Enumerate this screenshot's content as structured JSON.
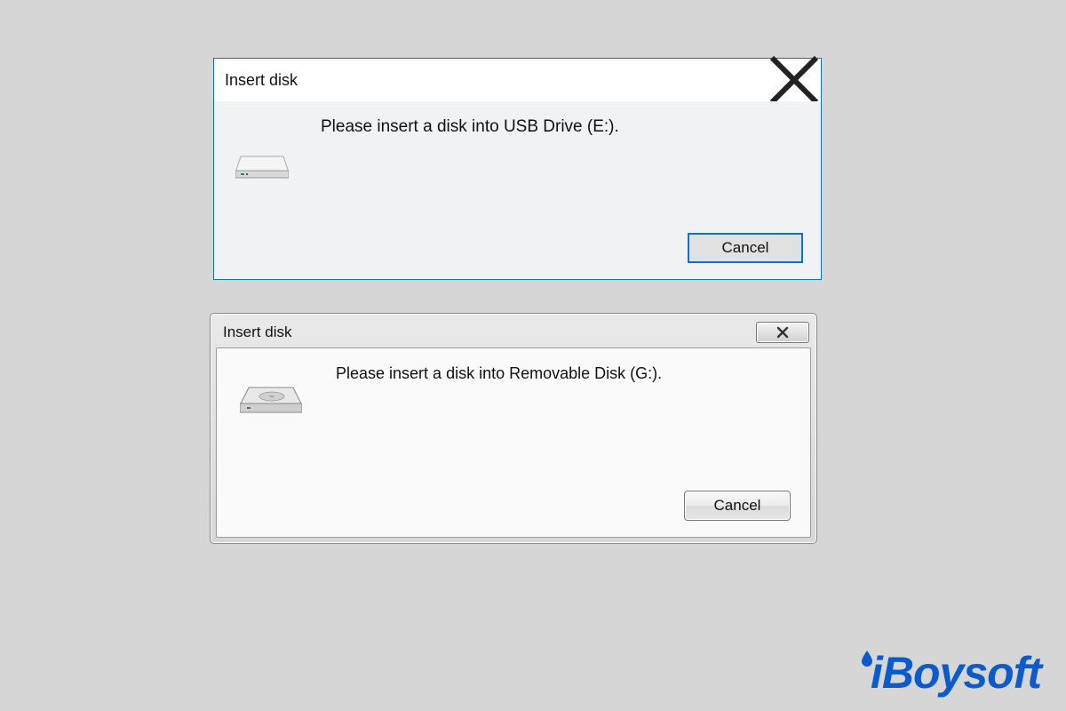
{
  "dialog1": {
    "title": "Insert disk",
    "message": "Please insert a disk into USB Drive (E:).",
    "cancel_label": "Cancel"
  },
  "dialog2": {
    "title": "Insert disk",
    "message": "Please insert a disk into Removable Disk (G:).",
    "cancel_label": "Cancel"
  },
  "watermark": {
    "text": "iBoysoft"
  }
}
